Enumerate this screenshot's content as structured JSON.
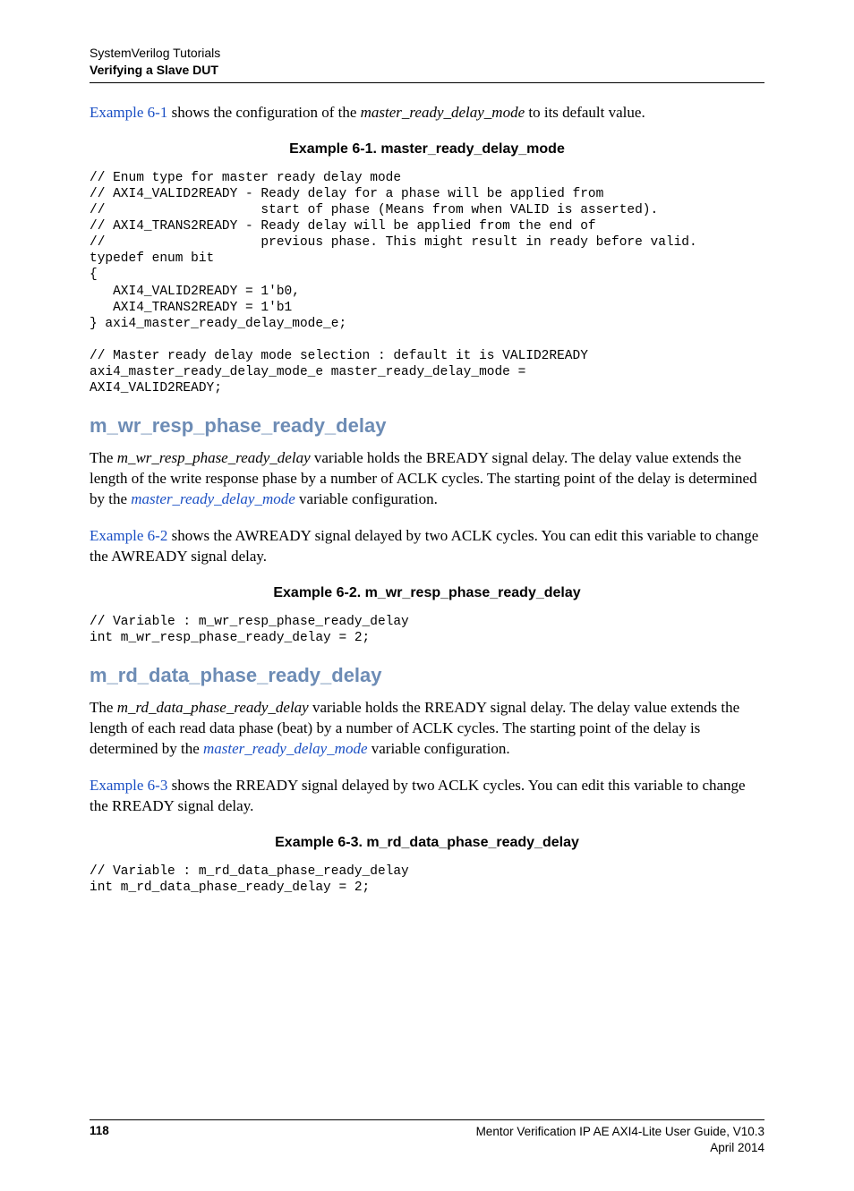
{
  "header": {
    "line1": "SystemVerilog Tutorials",
    "line2": "Verifying a Slave DUT"
  },
  "intro": {
    "linkText": "Example 6-1",
    "afterLink": " shows the configuration of the ",
    "italic": "master_ready_delay_mode",
    "tail": " to its default value."
  },
  "example1": {
    "title": "Example 6-1. master_ready_delay_mode",
    "code": "// Enum type for master ready delay mode\n// AXI4_VALID2READY - Ready delay for a phase will be applied from\n//                    start of phase (Means from when VALID is asserted).\n// AXI4_TRANS2READY - Ready delay will be applied from the end of\n//                    previous phase. This might result in ready before valid.\ntypedef enum bit\n{\n   AXI4_VALID2READY = 1'b0,\n   AXI4_TRANS2READY = 1'b1\n} axi4_master_ready_delay_mode_e;\n\n// Master ready delay mode selection : default it is VALID2READY\naxi4_master_ready_delay_mode_e master_ready_delay_mode =\nAXI4_VALID2READY;"
  },
  "section1": {
    "heading": "m_wr_resp_phase_ready_delay",
    "para1_pre": "The ",
    "para1_italic": "m_wr_resp_phase_ready_delay",
    "para1_mid": " variable holds the BREADY signal delay. The delay value extends the length of the write response phase by a number of ACLK cycles. The starting point of the delay is determined by the ",
    "para1_link": "master_ready_delay_mode",
    "para1_tail": " variable configuration.",
    "para2_link": "Example 6-2",
    "para2_rest": " shows the AWREADY signal delayed by two ACLK cycles. You can edit this variable to change the AWREADY signal delay."
  },
  "example2": {
    "title": "Example 6-2. m_wr_resp_phase_ready_delay",
    "code": "// Variable : m_wr_resp_phase_ready_delay\nint m_wr_resp_phase_ready_delay = 2;"
  },
  "section2": {
    "heading": "m_rd_data_phase_ready_delay",
    "para1_pre": "The ",
    "para1_italic": "m_rd_data_phase_ready_delay",
    "para1_mid": " variable holds the RREADY signal delay. The delay value extends the length of each read data phase (beat) by a number of ACLK cycles. The starting point of the delay is determined by the ",
    "para1_link": "master_ready_delay_mode",
    "para1_tail": " variable configuration.",
    "para2_link": "Example 6-3",
    "para2_rest": " shows the RREADY signal delayed by two ACLK cycles. You can edit this variable to change the RREADY signal delay."
  },
  "example3": {
    "title": "Example 6-3. m_rd_data_phase_ready_delay",
    "code": "// Variable : m_rd_data_phase_ready_delay\nint m_rd_data_phase_ready_delay = 2;"
  },
  "footer": {
    "pageNum": "118",
    "right1": "Mentor Verification IP AE AXI4-Lite User Guide, V10.3",
    "right2": "April 2014"
  }
}
